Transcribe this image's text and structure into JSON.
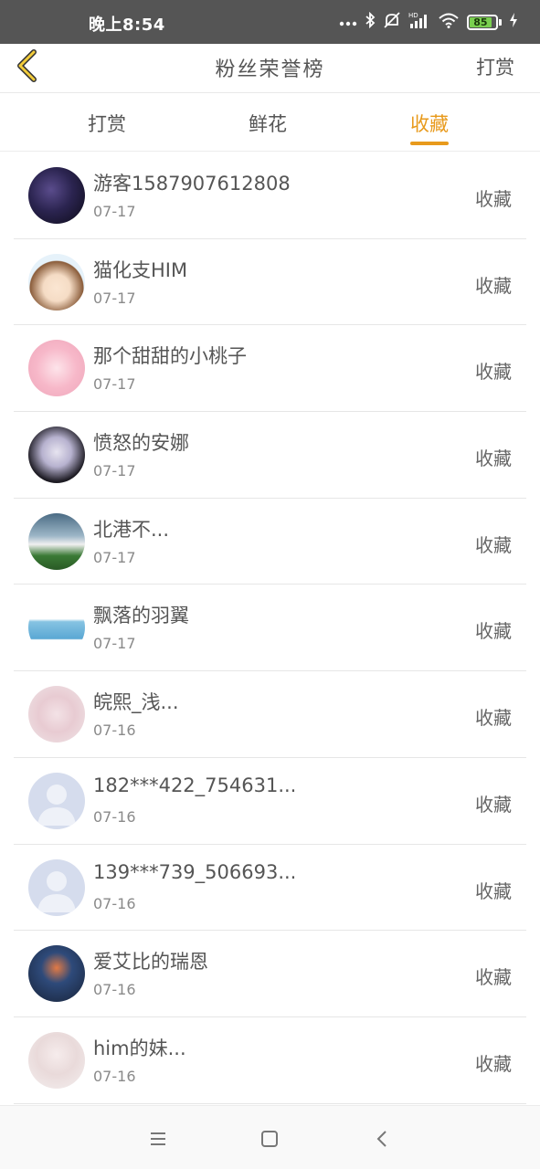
{
  "status_bar": {
    "time": "晚上8:54",
    "battery": "85",
    "icons": [
      "dots-icon",
      "bluetooth-icon",
      "alarm-off-icon",
      "hd-signal-icon",
      "wifi-icon",
      "battery-icon",
      "charging-icon"
    ]
  },
  "header": {
    "title": "粉丝荣誉榜",
    "action_label": "打赏",
    "accent_color": "#e89a1c"
  },
  "tabs": [
    {
      "label": "打赏",
      "active": false
    },
    {
      "label": "鲜花",
      "active": false
    },
    {
      "label": "收藏",
      "active": true
    }
  ],
  "fans": [
    {
      "name": "游客1587907612808",
      "date": "07-17",
      "action": "收藏"
    },
    {
      "name": "猫化支HIM",
      "date": "07-17",
      "action": "收藏"
    },
    {
      "name": "那个甜甜的小桃子",
      "date": "07-17",
      "action": "收藏"
    },
    {
      "name": "愤怒的安娜",
      "date": "07-17",
      "action": "收藏"
    },
    {
      "name": "北港不...",
      "date": "07-17",
      "action": "收藏"
    },
    {
      "name": "飘落的羽翼",
      "date": "07-17",
      "action": "收藏"
    },
    {
      "name": "皖熙_浅...",
      "date": "07-16",
      "action": "收藏"
    },
    {
      "name": "182***422_754631...",
      "date": "07-16",
      "action": "收藏"
    },
    {
      "name": "139***739_506693...",
      "date": "07-16",
      "action": "收藏"
    },
    {
      "name": "爱艾比的瑞恩",
      "date": "07-16",
      "action": "收藏"
    },
    {
      "name": "him的妹...",
      "date": "07-16",
      "action": "收藏"
    }
  ]
}
